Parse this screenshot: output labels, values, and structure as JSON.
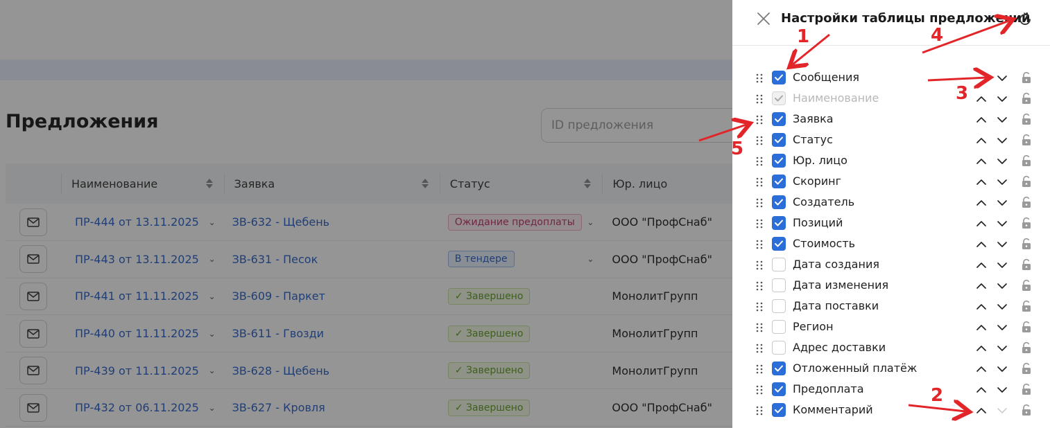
{
  "page": {
    "title": "Предложения",
    "search_placeholder": "ID предложения"
  },
  "table": {
    "columns": [
      "Наименование",
      "Заявка",
      "Статус",
      "Юр. лицо"
    ],
    "rows": [
      {
        "name": "ПР-444 от 13.11.2025",
        "request": "ЗВ-632 - Щебень",
        "status": "Ожидание предоплаты",
        "status_type": "pink",
        "legal": "ООО \"ПрофСнаб\""
      },
      {
        "name": "ПР-443 от 13.11.2025",
        "request": "ЗВ-631 - Песок",
        "status": "В тендере",
        "status_type": "blue",
        "legal": "ООО \"ПрофСнаб\""
      },
      {
        "name": "ПР-441 от 11.11.2025",
        "request": "ЗВ-609 - Паркет",
        "status": "Завершено",
        "status_type": "green",
        "legal": "МонолитГрупп"
      },
      {
        "name": "ПР-440 от 11.11.2025",
        "request": "ЗВ-611 - Гвозди",
        "status": "Завершено",
        "status_type": "green",
        "legal": "МонолитГрупп"
      },
      {
        "name": "ПР-439 от 11.11.2025",
        "request": "ЗВ-628 - Щебень",
        "status": "Завершено",
        "status_type": "green",
        "legal": "МонолитГрупп"
      },
      {
        "name": "ПР-432 от 06.11.2025",
        "request": "ЗВ-627 - Кровля",
        "status": "Завершено",
        "status_type": "green",
        "legal": "ООО \"ПрофСнаб\""
      }
    ]
  },
  "drawer": {
    "title": "Настройки таблицы предложений",
    "items": [
      {
        "label": "Сообщения",
        "checked": true,
        "disabled": false,
        "up": false,
        "down": true
      },
      {
        "label": "Наименование",
        "checked": true,
        "disabled": true,
        "up": true,
        "down": true
      },
      {
        "label": "Заявка",
        "checked": true,
        "disabled": false,
        "up": true,
        "down": true
      },
      {
        "label": "Статус",
        "checked": true,
        "disabled": false,
        "up": true,
        "down": true
      },
      {
        "label": "Юр. лицо",
        "checked": true,
        "disabled": false,
        "up": true,
        "down": true
      },
      {
        "label": "Скоринг",
        "checked": true,
        "disabled": false,
        "up": true,
        "down": true
      },
      {
        "label": "Создатель",
        "checked": true,
        "disabled": false,
        "up": true,
        "down": true
      },
      {
        "label": "Позиций",
        "checked": true,
        "disabled": false,
        "up": true,
        "down": true
      },
      {
        "label": "Стоимость",
        "checked": true,
        "disabled": false,
        "up": true,
        "down": true
      },
      {
        "label": "Дата создания",
        "checked": false,
        "disabled": false,
        "up": true,
        "down": true
      },
      {
        "label": "Дата изменения",
        "checked": false,
        "disabled": false,
        "up": true,
        "down": true
      },
      {
        "label": "Дата поставки",
        "checked": false,
        "disabled": false,
        "up": true,
        "down": true
      },
      {
        "label": "Регион",
        "checked": false,
        "disabled": false,
        "up": true,
        "down": true
      },
      {
        "label": "Адрес доставки",
        "checked": false,
        "disabled": false,
        "up": true,
        "down": true
      },
      {
        "label": "Отложенный платёж",
        "checked": true,
        "disabled": false,
        "up": true,
        "down": true
      },
      {
        "label": "Предоплата",
        "checked": true,
        "disabled": false,
        "up": true,
        "down": true
      },
      {
        "label": "Комментарий",
        "checked": true,
        "disabled": false,
        "up": true,
        "down": false
      }
    ]
  },
  "annotations": {
    "labels": [
      "1",
      "2",
      "3",
      "4",
      "5"
    ],
    "color": "#e22529"
  },
  "colors": {
    "accent": "#2b6ed8",
    "link": "#2a62c9"
  },
  "icons": [
    "close-icon",
    "refresh-icon",
    "drag-handle-icon",
    "checkmark-icon",
    "chevron-up-icon",
    "chevron-down-icon",
    "lock-icon",
    "mail-icon",
    "sort-icon"
  ]
}
